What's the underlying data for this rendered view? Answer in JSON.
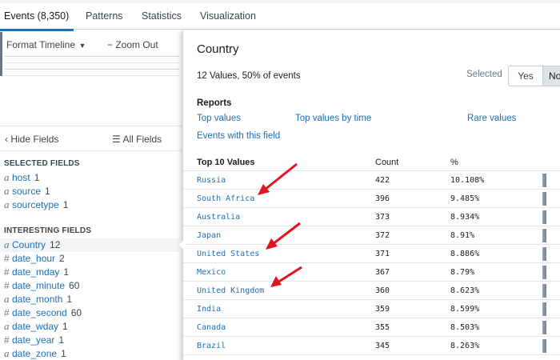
{
  "tabs": [
    {
      "label": "Events (8,350)",
      "active": true
    },
    {
      "label": "Patterns"
    },
    {
      "label": "Statistics"
    },
    {
      "label": "Visualization"
    }
  ],
  "toolbar": {
    "format_timeline": "Format Timeline",
    "zoom_out": "Zoom Out"
  },
  "fields_panel": {
    "hide_fields": "Hide Fields",
    "all_fields": "All Fields",
    "selected_title": "SELECTED FIELDS",
    "selected": [
      {
        "type": "a",
        "name": "host",
        "count": "1"
      },
      {
        "type": "a",
        "name": "source",
        "count": "1"
      },
      {
        "type": "a",
        "name": "sourcetype",
        "count": "1"
      }
    ],
    "interesting_title": "INTERESTING FIELDS",
    "interesting": [
      {
        "type": "a",
        "name": "Country",
        "count": "12"
      },
      {
        "type": "#",
        "name": "date_hour",
        "count": "2"
      },
      {
        "type": "#",
        "name": "date_mday",
        "count": "1"
      },
      {
        "type": "#",
        "name": "date_minute",
        "count": "60"
      },
      {
        "type": "a",
        "name": "date_month",
        "count": "1"
      },
      {
        "type": "#",
        "name": "date_second",
        "count": "60"
      },
      {
        "type": "a",
        "name": "date_wday",
        "count": "1"
      },
      {
        "type": "#",
        "name": "date_year",
        "count": "1"
      },
      {
        "type": "a",
        "name": "date_zone",
        "count": "1"
      }
    ]
  },
  "popup": {
    "title": "Country",
    "summary": "12 Values, 50% of events",
    "selected_label": "Selected",
    "yes": "Yes",
    "no": "No",
    "reports_title": "Reports",
    "links": {
      "top_values": "Top values",
      "top_values_by_time": "Top values by time",
      "rare_values": "Rare values",
      "events_with_field": "Events with this field"
    },
    "table": {
      "col_value": "Top 10 Values",
      "col_count": "Count",
      "col_pct": "%",
      "rows": [
        {
          "value": "Russia",
          "count": "422",
          "pct": "10.108%"
        },
        {
          "value": "South Africa",
          "count": "396",
          "pct": "9.485%"
        },
        {
          "value": "Australia",
          "count": "373",
          "pct": "8.934%"
        },
        {
          "value": "Japan",
          "count": "372",
          "pct": "8.91%"
        },
        {
          "value": "United States",
          "count": "371",
          "pct": "8.886%"
        },
        {
          "value": "Mexico",
          "count": "367",
          "pct": "8.79%"
        },
        {
          "value": "United Kingdom",
          "count": "360",
          "pct": "8.623%"
        },
        {
          "value": "India",
          "count": "359",
          "pct": "8.599%"
        },
        {
          "value": "Canada",
          "count": "355",
          "pct": "8.503%"
        },
        {
          "value": "Brazil",
          "count": "345",
          "pct": "8.263%"
        }
      ]
    }
  },
  "colors": {
    "link": "#1c6fb8",
    "annotation_arrow": "#e3141b"
  }
}
